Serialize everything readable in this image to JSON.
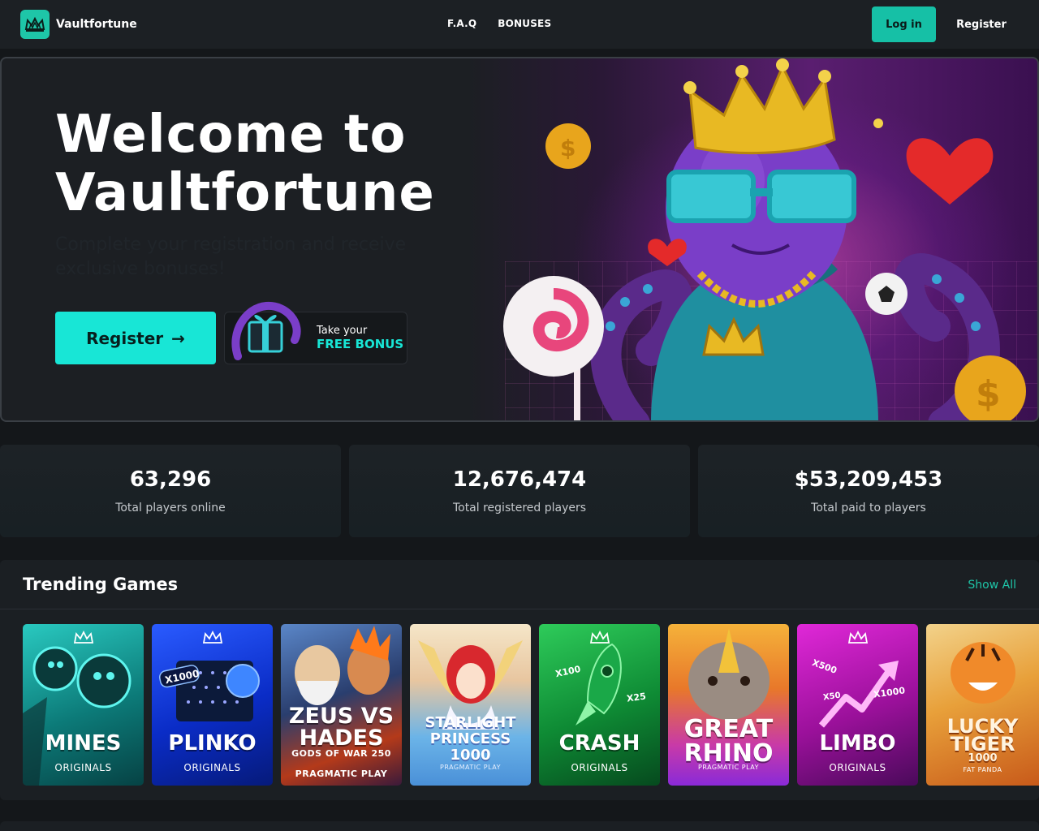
{
  "header": {
    "brand": "Vaultfortune",
    "nav": [
      "F.A.Q",
      "BONUSES"
    ],
    "login_label": "Log in",
    "register_label": "Register"
  },
  "hero": {
    "title_line1": "Welcome to",
    "title_line2": "Vaultfortune",
    "subtitle": "Complete your registration and receive exclusive bonuses!",
    "register_label": "Register",
    "register_arrow": "→",
    "bonus_line1": "Take your",
    "bonus_line2": "FREE BONUS"
  },
  "stats": [
    {
      "value": "63,296",
      "label": "Total players online"
    },
    {
      "value": "12,676,474",
      "label": "Total registered players"
    },
    {
      "value": "$53,209,453",
      "label": "Total paid to players"
    }
  ],
  "trending": {
    "title": "Trending Games",
    "show_all": "Show All",
    "games": [
      {
        "name": "MINES",
        "sub": "ORIGINALS"
      },
      {
        "name": "PLINKO",
        "sub": "ORIGINALS",
        "badge": "X1000"
      },
      {
        "name": "ZEUS VS HADES",
        "name_line1": "ZEUS VS",
        "name_line2": "HADES",
        "tagline": "GODS OF WAR 250",
        "sub": "PRAGMATIC PLAY"
      },
      {
        "name_line1": "STARLIGHT",
        "name_line2": "PRINCESS",
        "name_line3": "1000",
        "sub": "PRAGMATIC PLAY"
      },
      {
        "name": "CRASH",
        "sub": "ORIGINALS",
        "badges": [
          "X100",
          "X25"
        ]
      },
      {
        "name_line1": "GREAT",
        "name_line2": "RHINO",
        "sub": "PRAGMATIC PLAY"
      },
      {
        "name": "LIMBO",
        "sub": "ORIGINALS",
        "badges": [
          "X500",
          "X50",
          "X1000"
        ]
      },
      {
        "name_line1": "LUCKY",
        "name_line2": "TIGER",
        "name_line3": "1000",
        "sub": "FAT PANDA"
      }
    ]
  },
  "colors": {
    "accent": "#18e6d6",
    "brand_teal": "#16c0a6",
    "bg": "#14171a",
    "panel": "#1b1f23"
  },
  "icons": [
    "crown-logo-icon",
    "arrow-right-icon",
    "gift-icon"
  ]
}
